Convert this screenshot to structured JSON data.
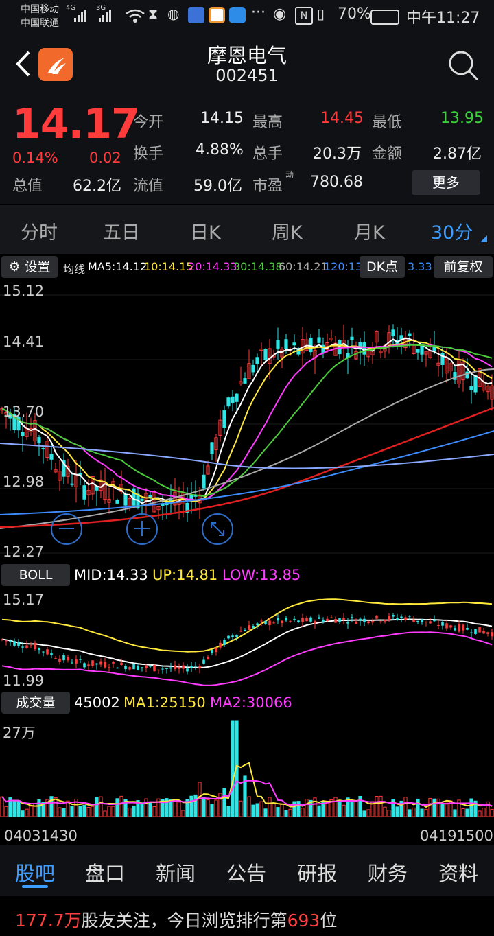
{
  "status": {
    "op1": "中国移动",
    "op2": "中国联通",
    "net1": "4G",
    "net2": "3G",
    "battery": "70%",
    "time": "中午11:27"
  },
  "header": {
    "name": "摩恩电气",
    "code": "002451"
  },
  "quote": {
    "price": "14.17",
    "pct": "0.14%",
    "change": "0.02",
    "open_label": "今开",
    "open": "14.15",
    "high_label": "最高",
    "high": "14.45",
    "low_label": "最低",
    "low": "13.95",
    "turnover_label": "换手",
    "turnover": "4.88%",
    "volume_label": "总手",
    "volume": "20.3万",
    "amount_label": "金额",
    "amount": "2.87亿",
    "mcap_label": "总值",
    "mcap": "62.2亿",
    "float_label": "流值",
    "float": "59.0亿",
    "pe_label": "市盈",
    "pe_sup": "动",
    "pe": "780.68",
    "more": "更多"
  },
  "tabs": [
    "分时",
    "五日",
    "日K",
    "周K",
    "月K",
    "30分"
  ],
  "toolbar": {
    "settings": "设置",
    "ma_label": "均线",
    "ma5": "MA5:14.12",
    "ma10": "10:14.15",
    "ma20": "20:14.33",
    "ma30": "30:14.38",
    "ma60": "60:14.21",
    "ma120": "120:13",
    "ma_more": "3.33",
    "dk": "DK点",
    "fq": "前复权"
  },
  "kline": {
    "y1": "15.12",
    "y2": "14.41",
    "y3": "13.70",
    "y4": "12.98",
    "y5": "12.27"
  },
  "boll": {
    "name": "BOLL",
    "mid": "MID:14.33",
    "up": "UP:14.81",
    "low": "LOW:13.85",
    "y1": "15.17",
    "y2": "11.99"
  },
  "volume": {
    "name": "成交量",
    "val": "45002",
    "ma1": "MA1:25150",
    "ma2": "MA2:30066",
    "y1": "27万",
    "start": "04031430",
    "end": "04191500"
  },
  "bottom_tabs": [
    "股吧",
    "盘口",
    "新闻",
    "公告",
    "研报",
    "财务",
    "资料"
  ],
  "footer": {
    "count": "177.7万",
    "text1": "股友关注，今日浏览排行第",
    "rank": "693",
    "text2": "位"
  },
  "colors": {
    "up": "#ff3b3b",
    "down": "#2ee6e6",
    "ma5": "#ffffff",
    "ma10": "#ffe83c",
    "ma20": "#ff3cff",
    "ma30": "#4ccc3c",
    "ma60": "#aaaaaa",
    "ma120": "#3c8cff",
    "accent": "#3c9cff"
  }
}
